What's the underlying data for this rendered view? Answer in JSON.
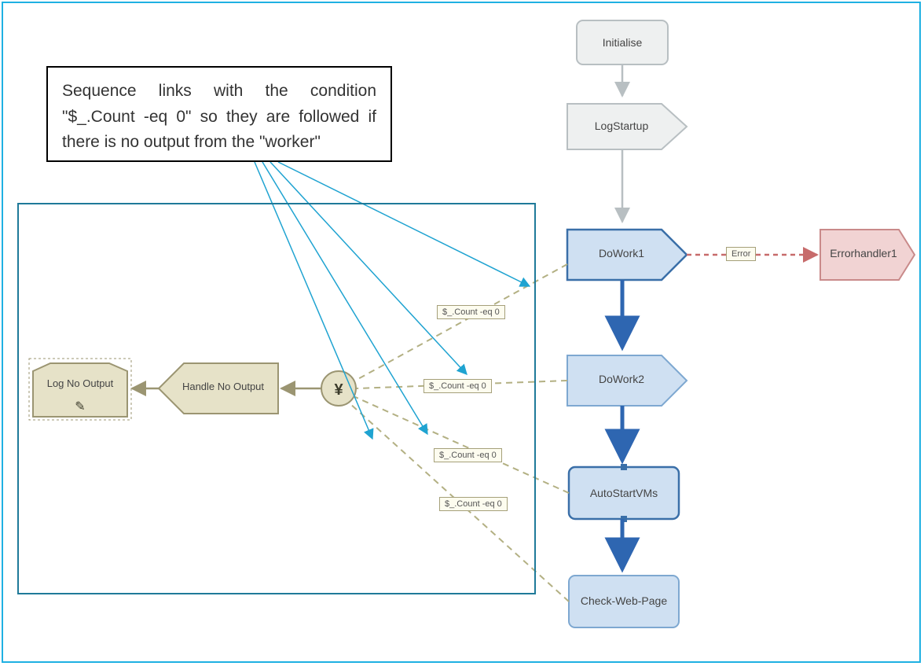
{
  "annotation": {
    "text": "Sequence links with the condition \"$_.Count -eq 0\" so they are followed if there is no output from the \"worker\""
  },
  "nodes": {
    "initialise": {
      "label": "Initialise"
    },
    "logstartup": {
      "label": "LogStartup"
    },
    "dowork1": {
      "label": "DoWork1"
    },
    "dowork2": {
      "label": "DoWork2"
    },
    "autostartvms": {
      "label": "AutoStartVMs"
    },
    "checkwebpage": {
      "label": "Check-Web-Page"
    },
    "errorhandler1": {
      "label": "Errorhandler1"
    },
    "handle_no_output": {
      "label": "Handle No Output"
    },
    "log_no_output": {
      "label": "Log No Output"
    }
  },
  "link_labels": {
    "error": "Error",
    "cond1": "$_.Count -eq 0",
    "cond2": "$_.Count -eq 0",
    "cond3": "$_.Count -eq 0",
    "cond4": "$_.Count -eq 0"
  },
  "colors": {
    "frame_border": "#1fb0e2",
    "selection_border": "#1f7a99",
    "grey_fill": "#eef0f0",
    "grey_stroke": "#b8bfc2",
    "blue_fill": "#cfe0f2",
    "blue_stroke": "#7ea8d1",
    "blue_bold_stroke": "#3a6fa8",
    "darkblue_arrow": "#2e66b1",
    "red_fill": "#f1d3d3",
    "red_stroke": "#c98a8a",
    "olive_fill": "#e6e2c8",
    "olive_stroke": "#9b9572",
    "annotation_arrow": "#1fa3d1",
    "dashed": "#b3b083"
  }
}
